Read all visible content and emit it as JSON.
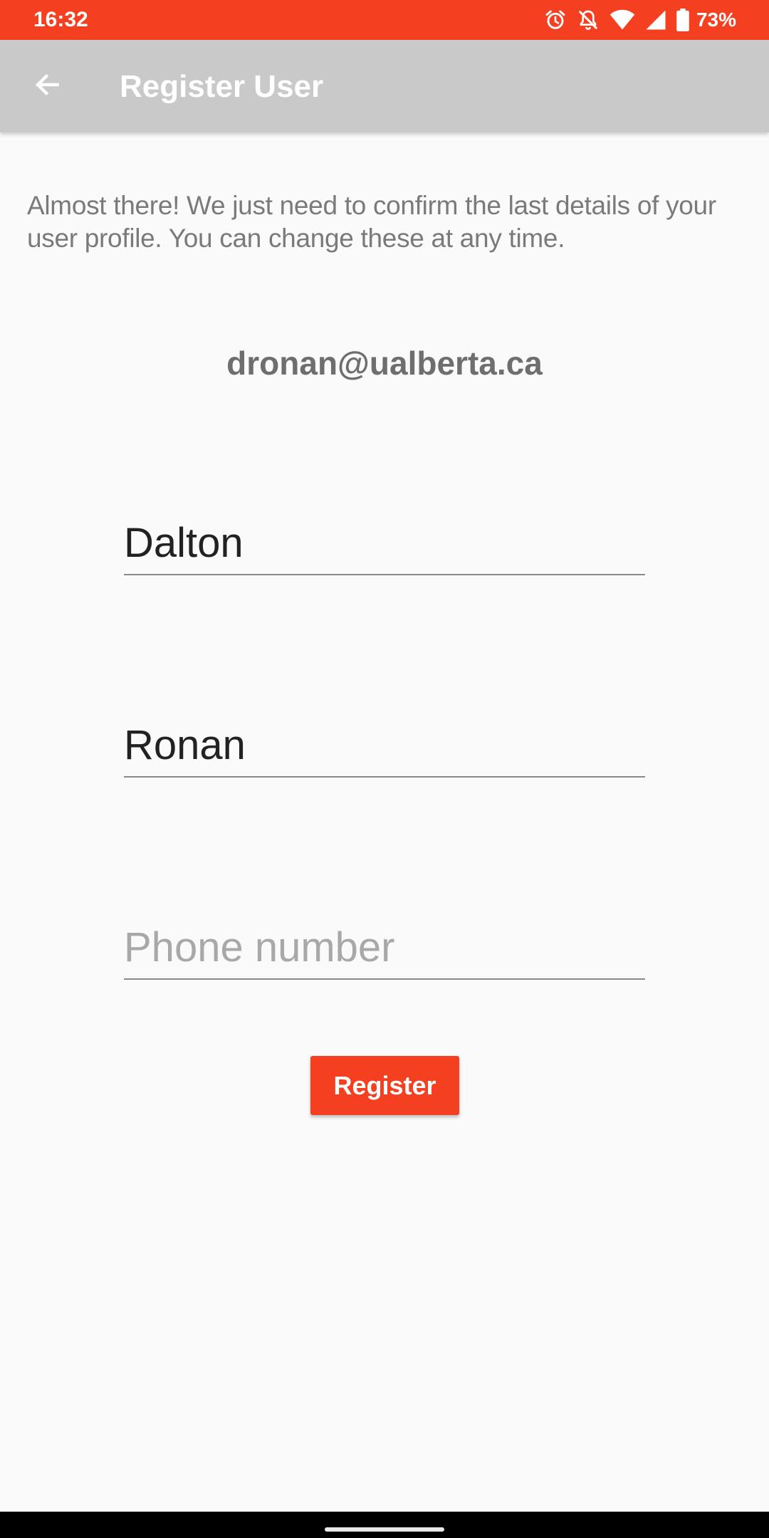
{
  "status_bar": {
    "time": "16:32",
    "battery_percent": "73%",
    "icons": [
      "alarm-icon",
      "notifications-off-icon",
      "wifi-icon",
      "signal-icon",
      "battery-icon"
    ]
  },
  "app_bar": {
    "title": "Register User",
    "back_icon": "arrow-back-icon"
  },
  "content": {
    "intro": "Almost there! We just need to confirm the last details of your user profile. You can change these at any time.",
    "email": "dronan@ualberta.ca",
    "first_name": {
      "value": "Dalton"
    },
    "last_name": {
      "value": "Ronan"
    },
    "phone": {
      "value": "",
      "placeholder": "Phone number"
    },
    "register_label": "Register"
  },
  "colors": {
    "accent": "#f44020",
    "app_bar": "#c9c9c9",
    "background": "#fafafa"
  }
}
